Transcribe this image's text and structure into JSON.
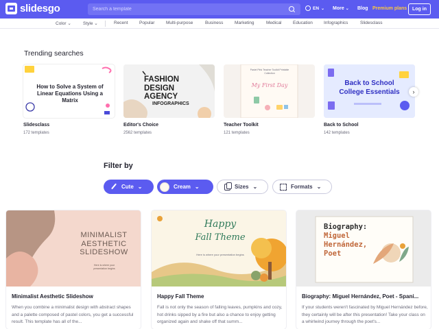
{
  "header": {
    "logo_text": "slidesgo",
    "search_placeholder": "Search a template",
    "lang": "EN",
    "more": "More",
    "blog": "Blog",
    "premium": "Premium plans",
    "login": "Log in",
    "brand_color": "#5b5bf0",
    "premium_color": "#ffc93a"
  },
  "categories": [
    "Color",
    "Style",
    "Recent",
    "Popular",
    "Multi-purpose",
    "Business",
    "Marketing",
    "Medical",
    "Education",
    "Infographics",
    "Slidesclass"
  ],
  "trending": {
    "title": "Trending searches",
    "items": [
      {
        "name": "Slidesclass",
        "count": "172 templates",
        "thumb_text": "How to Solve a System of Linear Equations Using a Matrix"
      },
      {
        "name": "Editor's Choice",
        "count": "2562 templates",
        "thumb_text": "FASHION DESIGN AGENCY",
        "thumb_sub": "INFOGRAPHICS"
      },
      {
        "name": "Teacher Toolkit",
        "count": "121 templates",
        "thumb_text": "My First Day",
        "thumb_small": "Pastel Pink Teacher Toolkit Printable Collection"
      },
      {
        "name": "Back to School",
        "count": "142 templates",
        "thumb_text": "Back to School",
        "thumb_text2": "College Essentials"
      }
    ]
  },
  "filter": {
    "title": "Filter by",
    "chips": [
      {
        "label": "Cute",
        "icon": "brush-icon"
      },
      {
        "label": "Cream",
        "icon": "color-swatch-icon"
      },
      {
        "label": "Sizes",
        "icon": "sizes-icon"
      },
      {
        "label": "Formats",
        "icon": "formats-icon"
      }
    ]
  },
  "results": [
    {
      "title": "Minimalist Aesthetic Slideshow",
      "thumb_text": "MINIMALIST AESTHETIC SLIDESHOW",
      "thumb_sub": "Here is where your presentation begins",
      "desc": "When you combine a minimalist design with abstract shapes and a palette composed of pastel colors, you get a successful result. This template has all of the..."
    },
    {
      "title": "Happy Fall Theme",
      "thumb_text": "Happy",
      "thumb_text2": "Fall Theme",
      "thumb_sub": "Here is where your presentation begins",
      "desc": "Fall is not only the season of falling leaves, pumpkins and cozy, hot drinks sipped by a fire but also a chance to enjoy getting organized again and shake off that summ..."
    },
    {
      "title": "Biography: Miguel Hernández, Poet - Spani...",
      "thumb_text": "Biography:",
      "thumb_text2": "Miguel",
      "thumb_text3": "Hernández,",
      "thumb_text4": "Poet",
      "desc": "If your students weren't fascinated by Miguel Hernández before, they certainly will be after this presentation! Take your class on a whirlwind journey through the poet's..."
    }
  ]
}
